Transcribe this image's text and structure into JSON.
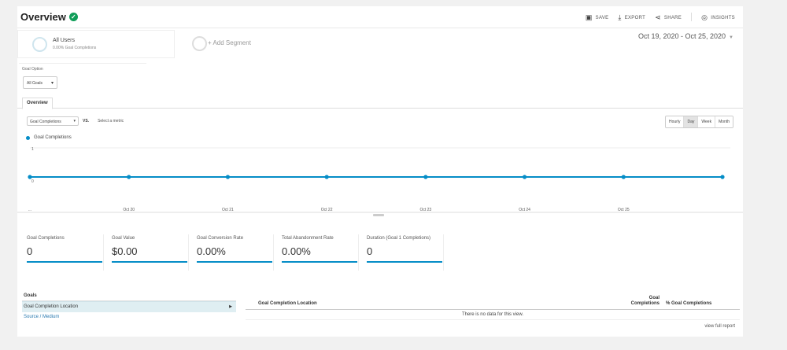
{
  "header": {
    "title": "Overview",
    "tools": [
      {
        "icon": "save-icon",
        "glyph": "▣",
        "label": "SAVE"
      },
      {
        "icon": "export-icon",
        "glyph": "⤓",
        "label": "EXPORT"
      },
      {
        "icon": "share-icon",
        "glyph": "⋖",
        "label": "SHARE"
      },
      {
        "icon": "insights-icon",
        "glyph": "◎",
        "label": "INSIGHTS"
      }
    ]
  },
  "segments": {
    "primary_name": "All Users",
    "primary_sub": "0.00% Goal Completions",
    "add_label": "+ Add Segment"
  },
  "date_range": "Oct 19, 2020 - Oct 25, 2020",
  "goal_option": {
    "label": "Goal Option",
    "value": "All Goals"
  },
  "tabs": {
    "overview": "Overview"
  },
  "metrics": {
    "selected": "Goal Completions",
    "vs": "VS.",
    "select_metric": "Select a metric"
  },
  "granularity": [
    {
      "label": "Hourly",
      "active": false
    },
    {
      "label": "Day",
      "active": true
    },
    {
      "label": "Week",
      "active": false
    },
    {
      "label": "Month",
      "active": false
    }
  ],
  "chart_data": {
    "type": "line",
    "series": [
      {
        "name": "Goal Completions",
        "values": [
          0,
          0,
          0,
          0,
          0,
          0,
          0,
          0
        ]
      }
    ],
    "x": [
      "...",
      "Oct 20",
      "Oct 21",
      "Oct 22",
      "Oct 23",
      "Oct 24",
      "Oct 25",
      ""
    ],
    "ylim": [
      0,
      1
    ],
    "y_ticks": [
      "1",
      "0"
    ],
    "color": "#058dc7"
  },
  "scorecards": [
    {
      "label": "Goal Completions",
      "value": "0"
    },
    {
      "label": "Goal Value",
      "value": "$0.00"
    },
    {
      "label": "Goal Conversion Rate",
      "value": "0.00%"
    },
    {
      "label": "Total Abandonment Rate",
      "value": "0.00%"
    },
    {
      "label": "Duration (Goal 1 Completions)",
      "value": "0"
    }
  ],
  "goals_panel": {
    "header": "Goals",
    "selected_item": "Goal Completion Location",
    "link": "Source / Medium"
  },
  "table": {
    "col1": "Goal Completion Location",
    "col2_line1": "Goal",
    "col2_line2": "Completions",
    "col3": "% Goal Completions",
    "empty": "There is no data for this view.",
    "full_report": "view full report"
  }
}
